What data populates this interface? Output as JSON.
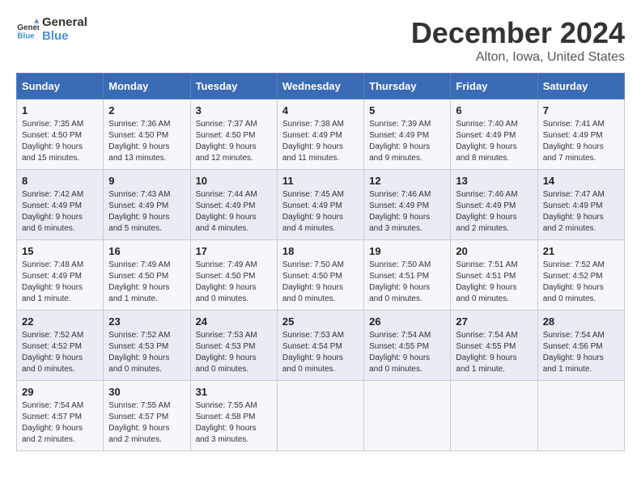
{
  "header": {
    "logo_line1": "General",
    "logo_line2": "Blue",
    "month": "December 2024",
    "location": "Alton, Iowa, United States"
  },
  "weekdays": [
    "Sunday",
    "Monday",
    "Tuesday",
    "Wednesday",
    "Thursday",
    "Friday",
    "Saturday"
  ],
  "weeks": [
    [
      {
        "day": "1",
        "sunrise": "7:35 AM",
        "sunset": "4:50 PM",
        "daylight": "9 hours and 15 minutes."
      },
      {
        "day": "2",
        "sunrise": "7:36 AM",
        "sunset": "4:50 PM",
        "daylight": "9 hours and 13 minutes."
      },
      {
        "day": "3",
        "sunrise": "7:37 AM",
        "sunset": "4:50 PM",
        "daylight": "9 hours and 12 minutes."
      },
      {
        "day": "4",
        "sunrise": "7:38 AM",
        "sunset": "4:49 PM",
        "daylight": "9 hours and 11 minutes."
      },
      {
        "day": "5",
        "sunrise": "7:39 AM",
        "sunset": "4:49 PM",
        "daylight": "9 hours and 9 minutes."
      },
      {
        "day": "6",
        "sunrise": "7:40 AM",
        "sunset": "4:49 PM",
        "daylight": "9 hours and 8 minutes."
      },
      {
        "day": "7",
        "sunrise": "7:41 AM",
        "sunset": "4:49 PM",
        "daylight": "9 hours and 7 minutes."
      }
    ],
    [
      {
        "day": "8",
        "sunrise": "7:42 AM",
        "sunset": "4:49 PM",
        "daylight": "9 hours and 6 minutes."
      },
      {
        "day": "9",
        "sunrise": "7:43 AM",
        "sunset": "4:49 PM",
        "daylight": "9 hours and 5 minutes."
      },
      {
        "day": "10",
        "sunrise": "7:44 AM",
        "sunset": "4:49 PM",
        "daylight": "9 hours and 4 minutes."
      },
      {
        "day": "11",
        "sunrise": "7:45 AM",
        "sunset": "4:49 PM",
        "daylight": "9 hours and 4 minutes."
      },
      {
        "day": "12",
        "sunrise": "7:46 AM",
        "sunset": "4:49 PM",
        "daylight": "9 hours and 3 minutes."
      },
      {
        "day": "13",
        "sunrise": "7:46 AM",
        "sunset": "4:49 PM",
        "daylight": "9 hours and 2 minutes."
      },
      {
        "day": "14",
        "sunrise": "7:47 AM",
        "sunset": "4:49 PM",
        "daylight": "9 hours and 2 minutes."
      }
    ],
    [
      {
        "day": "15",
        "sunrise": "7:48 AM",
        "sunset": "4:49 PM",
        "daylight": "9 hours and 1 minute."
      },
      {
        "day": "16",
        "sunrise": "7:49 AM",
        "sunset": "4:50 PM",
        "daylight": "9 hours and 1 minute."
      },
      {
        "day": "17",
        "sunrise": "7:49 AM",
        "sunset": "4:50 PM",
        "daylight": "9 hours and 0 minutes."
      },
      {
        "day": "18",
        "sunrise": "7:50 AM",
        "sunset": "4:50 PM",
        "daylight": "9 hours and 0 minutes."
      },
      {
        "day": "19",
        "sunrise": "7:50 AM",
        "sunset": "4:51 PM",
        "daylight": "9 hours and 0 minutes."
      },
      {
        "day": "20",
        "sunrise": "7:51 AM",
        "sunset": "4:51 PM",
        "daylight": "9 hours and 0 minutes."
      },
      {
        "day": "21",
        "sunrise": "7:52 AM",
        "sunset": "4:52 PM",
        "daylight": "9 hours and 0 minutes."
      }
    ],
    [
      {
        "day": "22",
        "sunrise": "7:52 AM",
        "sunset": "4:52 PM",
        "daylight": "9 hours and 0 minutes."
      },
      {
        "day": "23",
        "sunrise": "7:52 AM",
        "sunset": "4:53 PM",
        "daylight": "9 hours and 0 minutes."
      },
      {
        "day": "24",
        "sunrise": "7:53 AM",
        "sunset": "4:53 PM",
        "daylight": "9 hours and 0 minutes."
      },
      {
        "day": "25",
        "sunrise": "7:53 AM",
        "sunset": "4:54 PM",
        "daylight": "9 hours and 0 minutes."
      },
      {
        "day": "26",
        "sunrise": "7:54 AM",
        "sunset": "4:55 PM",
        "daylight": "9 hours and 0 minutes."
      },
      {
        "day": "27",
        "sunrise": "7:54 AM",
        "sunset": "4:55 PM",
        "daylight": "9 hours and 1 minute."
      },
      {
        "day": "28",
        "sunrise": "7:54 AM",
        "sunset": "4:56 PM",
        "daylight": "9 hours and 1 minute."
      }
    ],
    [
      {
        "day": "29",
        "sunrise": "7:54 AM",
        "sunset": "4:57 PM",
        "daylight": "9 hours and 2 minutes."
      },
      {
        "day": "30",
        "sunrise": "7:55 AM",
        "sunset": "4:57 PM",
        "daylight": "9 hours and 2 minutes."
      },
      {
        "day": "31",
        "sunrise": "7:55 AM",
        "sunset": "4:58 PM",
        "daylight": "9 hours and 3 minutes."
      },
      null,
      null,
      null,
      null
    ]
  ]
}
